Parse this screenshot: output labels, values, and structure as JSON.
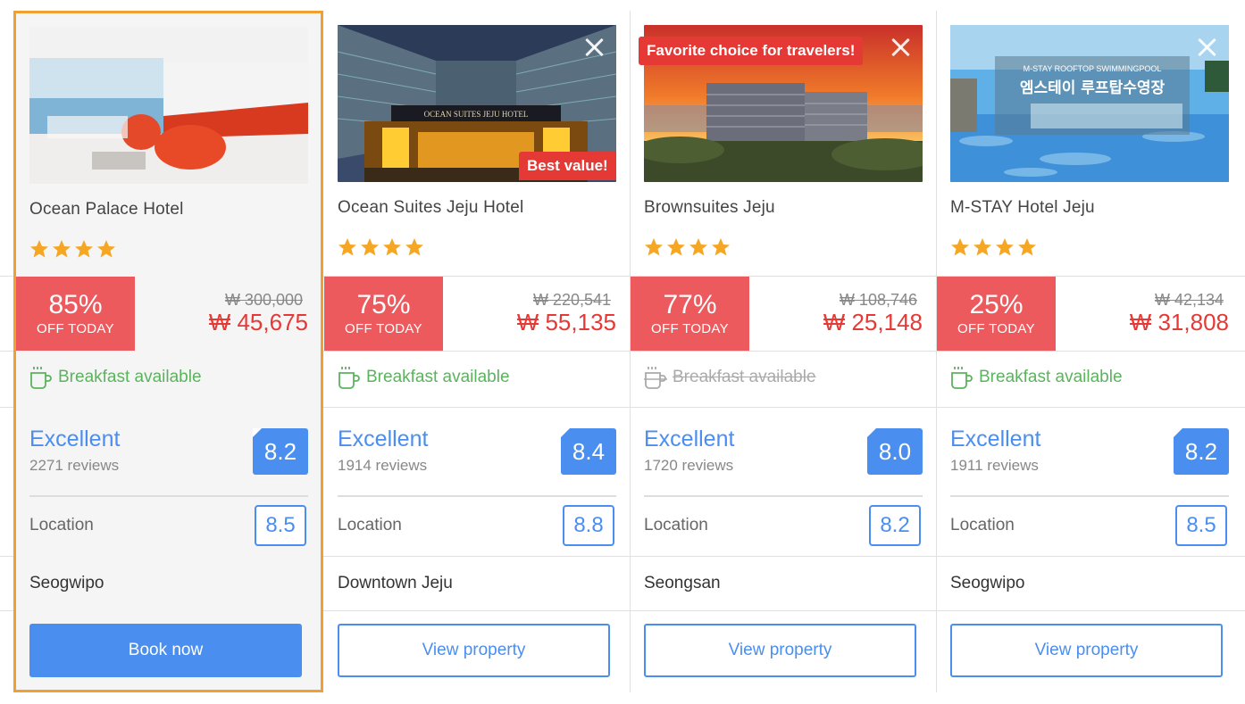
{
  "hotels": [
    {
      "name": "Ocean Palace Hotel",
      "stars": 4,
      "discount_pct": "85%",
      "discount_label": "OFF TODAY",
      "old_price": "₩ 300,000",
      "new_price": "₩ 45,675",
      "breakfast": "Breakfast available",
      "breakfast_available": true,
      "rating_word": "Excellent",
      "reviews": "2271 reviews",
      "score": "8.2",
      "location_label": "Location",
      "location_score": "8.5",
      "district": "Seogwipo",
      "button": "Book now",
      "selected": true
    },
    {
      "name": "Ocean Suites Jeju Hotel",
      "stars": 4,
      "badge": "Best value!",
      "discount_pct": "75%",
      "discount_label": "OFF TODAY",
      "old_price": "₩ 220,541",
      "new_price": "₩ 55,135",
      "breakfast": "Breakfast available",
      "breakfast_available": true,
      "rating_word": "Excellent",
      "reviews": "1914 reviews",
      "score": "8.4",
      "location_label": "Location",
      "location_score": "8.8",
      "district": "Downtown Jeju",
      "button": "View property",
      "photo_text": "OCEAN SUITES JEJU HOTEL"
    },
    {
      "name": "Brownsuites Jeju",
      "stars": 4,
      "badge": "Favorite choice for travelers!",
      "discount_pct": "77%",
      "discount_label": "OFF TODAY",
      "old_price": "₩ 108,746",
      "new_price": "₩ 25,148",
      "breakfast": "Breakfast available",
      "breakfast_available": false,
      "rating_word": "Excellent",
      "reviews": "1720 reviews",
      "score": "8.0",
      "location_label": "Location",
      "location_score": "8.2",
      "district": "Seongsan",
      "button": "View property"
    },
    {
      "name": "M-STAY Hotel Jeju",
      "stars": 4,
      "discount_pct": "25%",
      "discount_label": "OFF TODAY",
      "old_price": "₩ 42,134",
      "new_price": "₩ 31,808",
      "breakfast": "Breakfast available",
      "breakfast_available": true,
      "rating_word": "Excellent",
      "reviews": "1911 reviews",
      "score": "8.2",
      "location_label": "Location",
      "location_score": "8.5",
      "district": "Seogwipo",
      "button": "View property",
      "photo_text": [
        "M-STAY ROOFTOP SWIMMINGPOOL",
        "엠스테이 루프탑수영장"
      ]
    }
  ],
  "colors": {
    "accent_blue": "#4a8ef0",
    "discount_red": "#ed5a5d",
    "price_red": "#e53935",
    "breakfast_green": "#5bb35e",
    "star_orange": "#f5a623",
    "selected_border": "#f0a030"
  },
  "icons": [
    "close-icon",
    "star-icon",
    "coffee-cup-icon"
  ]
}
